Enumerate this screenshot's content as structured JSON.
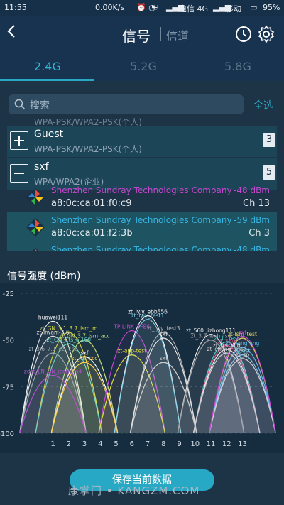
{
  "status": {
    "time": "11:55",
    "speed": "0.00K/s",
    "carrier1": "电信 4G",
    "carrier2": "移动",
    "battery": "95%"
  },
  "header": {
    "title": "信号",
    "title2": "信道"
  },
  "tabs": [
    {
      "label": "2.4G"
    },
    {
      "label": "5.2G"
    },
    {
      "label": "5.8G"
    }
  ],
  "search": {
    "placeholder": "搜索",
    "select_all": "全选"
  },
  "list": {
    "cut_text": "WPA-PSK/WPA2-PSK(个人)",
    "groups": [
      {
        "name": "Guest",
        "security": "WPA-PSK/WPA2-PSK(个人)",
        "count": "3"
      },
      {
        "name": "sxf",
        "security": "WPA/WPA2(企业)",
        "count": "5"
      }
    ],
    "aps": [
      {
        "vendor": "Shenzhen Sundray Technologies Company",
        "mac": "a8:0c:ca:01:f0:c9",
        "dbm": "-48 dBm",
        "channel": "Ch 13",
        "color": "#c447cf"
      },
      {
        "vendor": "Shenzhen Sundray Technologies Company",
        "mac": "a8:0c:ca:01:f2:3b",
        "dbm": "-59 dBm",
        "channel": "Ch 3",
        "color": "#39b5e4"
      },
      {
        "vendor": "Shenzhen Sundray Technologies Company",
        "mac": "",
        "dbm": "-48 dBm",
        "channel": "",
        "color": "#39b5e4"
      }
    ]
  },
  "chart_title": "信号强度 (dBm)",
  "chart_data": {
    "type": "area",
    "xlabel": "",
    "ylabel": "",
    "ylim": [
      -100,
      -25
    ],
    "xlim": [
      -1,
      15
    ],
    "y_ticks": [
      "-25",
      "-50",
      "-75",
      "-100"
    ],
    "x_ticks": [
      "1",
      "2",
      "3",
      "4",
      "5",
      "6",
      "7",
      "8",
      "9",
      "10",
      "11",
      "12",
      "13"
    ],
    "series": [
      {
        "name": "huawei111",
        "channel": 1,
        "dbm": -40,
        "color": "#f2f2f2"
      },
      {
        "name": "zt-liwanj-3.6",
        "channel": 1,
        "dbm": -48,
        "color": "#dcdcdc"
      },
      {
        "name": "zt_GN_3.1_3.7_lsm_m",
        "channel": 2,
        "dbm": -46,
        "color": "#d8d840"
      },
      {
        "name": "zt_GN_3.7_lsm_acc",
        "channel": 3,
        "dbm": -50,
        "color": "#c8e07a"
      },
      {
        "name": "zt_GN_Cts_al160",
        "channel": 2,
        "dbm": -52,
        "color": "#6fd6c6"
      },
      {
        "name": "zt_3.6_7.1_czj_ccz",
        "channel": 1,
        "dbm": -57,
        "color": "#9aa6b0"
      },
      {
        "name": "sxf",
        "channel": 3,
        "dbm": -59,
        "color": "#ffffff"
      },
      {
        "name": "zdzt_LN_GN_jcong_a4",
        "channel": 1,
        "dbm": -69,
        "color": "#b04fd0"
      },
      {
        "name": "zt_ffff_ccc",
        "channel": 3,
        "dbm": -62,
        "color": "#ffd24a"
      },
      {
        "name": "TP-LINK_3FE6",
        "channel": 6,
        "dbm": -45,
        "color": "#c447cf"
      },
      {
        "name": "zt-app-test",
        "channel": 6,
        "dbm": -58,
        "color": "#dede3a"
      },
      {
        "name": "zt_lyjy_ebb556",
        "channel": 7,
        "dbm": -37,
        "color": "#ffffff"
      },
      {
        "name": "zt_lyjy_test1",
        "channel": 7,
        "dbm": -39,
        "color": "#7fd6ee"
      },
      {
        "name": "zt_lyjy_test3",
        "channel": 8,
        "dbm": -46,
        "color": "#bbbbbb"
      },
      {
        "name": "sxf",
        "channel": 8,
        "dbm": -49,
        "color": "#e6e6e6"
      },
      {
        "name": "sxf",
        "channel": 8,
        "dbm": -62,
        "color": "#d0d0d0"
      },
      {
        "name": "zt_560_jizhong111",
        "channel": 11,
        "dbm": -47,
        "color": "#f0f0f0"
      },
      {
        "name": "zt_3.7_wxh_fsd",
        "channel": 11,
        "dbm": -50,
        "color": "#a0a0a0"
      },
      {
        "name": "zt_lc_test",
        "channel": 12,
        "dbm": -51,
        "color": "#4ad2c8"
      },
      {
        "name": "zt-lsm_test",
        "channel": 13,
        "dbm": -49,
        "color": "#e8d85a"
      },
      {
        "name": "zt_560",
        "channel": 12,
        "dbm": -53,
        "color": "#e45a8e"
      },
      {
        "name": "zt_wangfang",
        "channel": 13,
        "dbm": -54,
        "color": "#5bbde9"
      },
      {
        "name": "zt_lxs_KLb",
        "channel": 12,
        "dbm": -55,
        "color": "#f0f0f0"
      },
      {
        "name": "zt_chong_shao",
        "channel": 12,
        "dbm": -57,
        "color": "#cfcfcf"
      },
      {
        "name": "Guest",
        "channel": 13,
        "dbm": -58,
        "color": "#7fd6ee"
      },
      {
        "name": "zt_zp",
        "channel": 13,
        "dbm": -60,
        "color": "#d8d8d8"
      },
      {
        "name": "sxf",
        "channel": 13,
        "dbm": -48,
        "color": "#c447cf"
      }
    ]
  },
  "footer": {
    "save_label": "保存当前数据",
    "watermark": "康掌门 • KANGZM.COM"
  }
}
